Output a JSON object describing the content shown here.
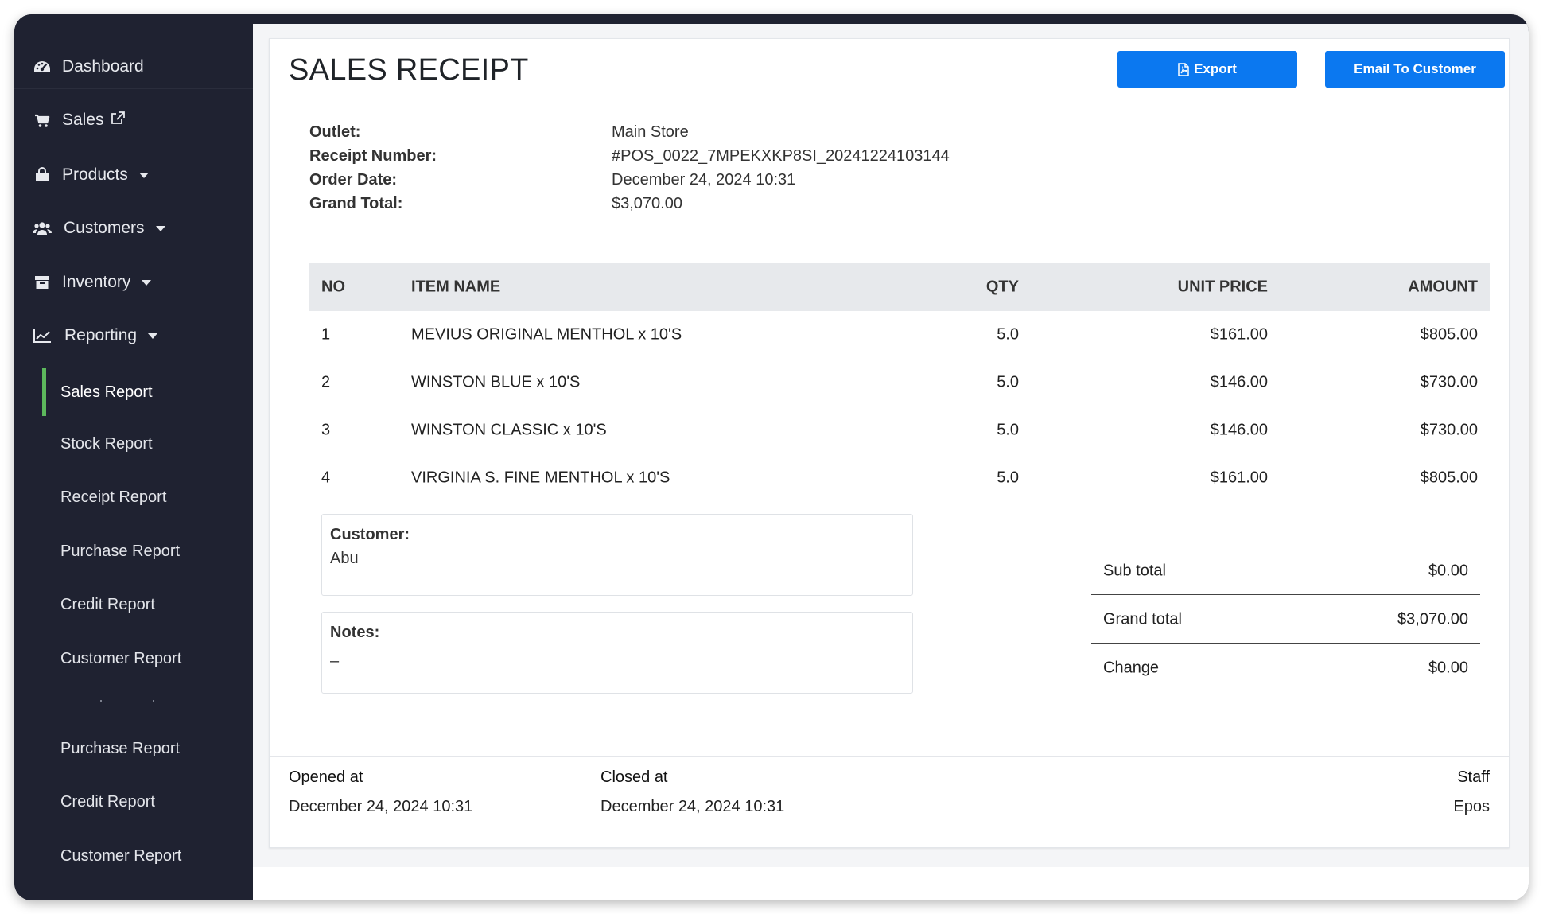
{
  "sidebar": {
    "items": [
      {
        "label": "Dashboard",
        "icon": "dashboard-icon"
      },
      {
        "label": "Sales",
        "icon": "cart-icon"
      },
      {
        "label": "Products",
        "icon": "bag-icon"
      },
      {
        "label": "Customers",
        "icon": "users-icon"
      },
      {
        "label": "Inventory",
        "icon": "archive-icon"
      },
      {
        "label": "Reporting",
        "icon": "chart-line-icon"
      }
    ],
    "reporting_sub": [
      {
        "label": "Sales Report",
        "active": true
      },
      {
        "label": "Stock Report"
      },
      {
        "label": "Receipt Report"
      },
      {
        "label": "Purchase Report"
      },
      {
        "label": "Credit Report"
      },
      {
        "label": "Customer Report"
      },
      {
        "label": "Purchase Report"
      },
      {
        "label": "Credit Report"
      },
      {
        "label": "Customer Report"
      }
    ],
    "active_color": "#5cb85c"
  },
  "header": {
    "title": "SALES RECEIPT",
    "export_label": "Export",
    "email_label": "Email To Customer",
    "button_color": "#0b78f0"
  },
  "info": {
    "outlet_label": "Outlet:",
    "outlet_value": "Main Store",
    "receipt_label": "Receipt Number:",
    "receipt_value": "#POS_0022_7MPEKXKP8SI_20241224103144",
    "date_label": "Order Date:",
    "date_value": "December 24, 2024 10:31",
    "total_label": "Grand Total:",
    "total_value": "$3,070.00"
  },
  "table": {
    "headers": {
      "no": "NO",
      "name": "ITEM NAME",
      "qty": "QTY",
      "price": "UNIT PRICE",
      "amount": "AMOUNT"
    },
    "rows": [
      {
        "no": "1",
        "name": "MEVIUS ORIGINAL MENTHOL x 10'S",
        "qty": "5.0",
        "price": "$161.00",
        "amount": "$805.00"
      },
      {
        "no": "2",
        "name": "WINSTON BLUE x 10'S",
        "qty": "5.0",
        "price": "$146.00",
        "amount": "$730.00"
      },
      {
        "no": "3",
        "name": "WINSTON CLASSIC x 10'S",
        "qty": "5.0",
        "price": "$146.00",
        "amount": "$730.00"
      },
      {
        "no": "4",
        "name": "VIRGINIA S. FINE MENTHOL x 10'S",
        "qty": "5.0",
        "price": "$161.00",
        "amount": "$805.00"
      }
    ]
  },
  "customer": {
    "label": "Customer:",
    "value": "Abu"
  },
  "notes": {
    "label": "Notes:",
    "value": "–"
  },
  "totals": {
    "subtotal_label": "Sub total",
    "subtotal_value": "$0.00",
    "grand_label": "Grand total",
    "grand_value": "$3,070.00",
    "change_label": "Change",
    "change_value": "$0.00"
  },
  "footer": {
    "opened_label": "Opened at",
    "opened_value": "December 24, 2024 10:31",
    "closed_label": "Closed at",
    "closed_value": "December 24, 2024 10:31",
    "staff_label": "Staff",
    "staff_value": "Epos"
  }
}
